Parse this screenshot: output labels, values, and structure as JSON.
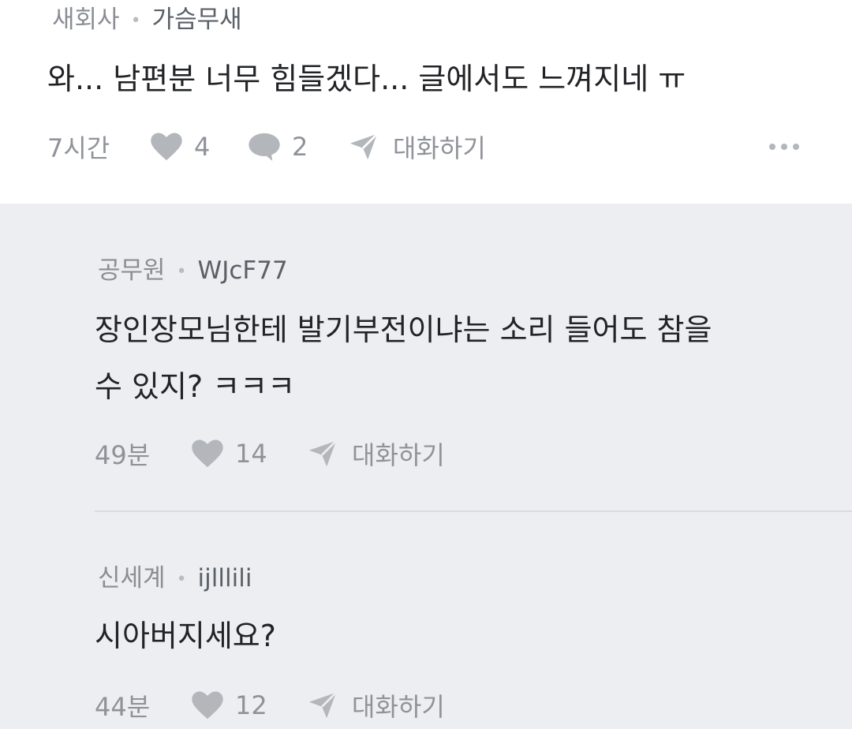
{
  "top_comment": {
    "company": "새회사",
    "nickname": "가슴무새",
    "text": "와... 남편분 너무 힘들겠다... 글에서도 느껴지네 ㅠ",
    "time": "7시간",
    "likes": "4",
    "comments": "2",
    "chat_label": "대화하기"
  },
  "replies": [
    {
      "company": "공무원",
      "nickname": "WJcF77",
      "text_line1": "장인장모님한테 발기부전이냐는 소리 들어도 참을",
      "text_line2": "수 있지? ㅋㅋㅋ",
      "time": "49분",
      "likes": "14",
      "chat_label": "대화하기"
    },
    {
      "company": "신세계",
      "nickname": "ijlllili",
      "text_line1": "시아버지세요?",
      "time": "44분",
      "likes": "12",
      "chat_label": "대화하기"
    }
  ],
  "icons": {
    "like": "heart-icon",
    "comment": "speech-bubble-icon",
    "chat": "paper-plane-icon",
    "more": "more-dots-icon"
  },
  "colors": {
    "reply_background": "#eceef1",
    "text": "#222326",
    "muted": "#8f9399",
    "icon": "#b3b6bb"
  }
}
